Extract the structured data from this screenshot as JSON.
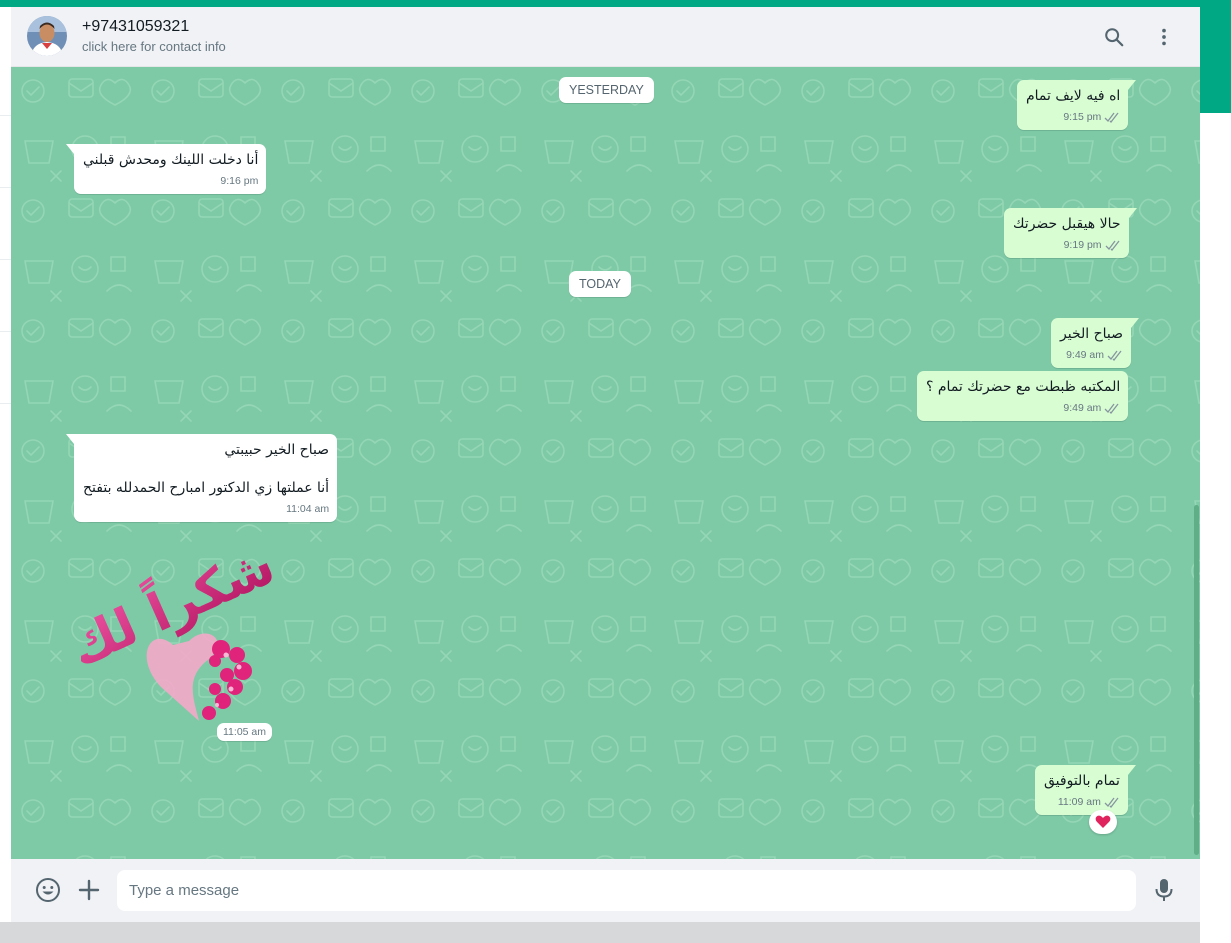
{
  "header": {
    "contact_name": "+97431059321",
    "contact_subtitle": "click here for contact info",
    "icons": {
      "avatar": "avatar",
      "search": "search-icon",
      "menu": "menu-icon"
    }
  },
  "chat": {
    "date_dividers": [
      "YESTERDAY",
      "TODAY"
    ],
    "messages": [
      {
        "dir": "out",
        "text": "اه فيه لايف تمام",
        "time": "9:15 pm",
        "status": "read"
      },
      {
        "dir": "in",
        "text": "أنا دخلت اللينك ومحدش قبلني",
        "time": "9:16 pm"
      },
      {
        "dir": "out",
        "text": "حالا هيقبل حضرتك",
        "time": "9:19 pm",
        "status": "read"
      },
      {
        "dir": "out",
        "text": "صباح الخير",
        "time": "9:49 am",
        "status": "read"
      },
      {
        "dir": "out",
        "text": "المكتبه ظبطت مع حضرتك تمام ؟",
        "time": "9:49 am",
        "status": "read"
      },
      {
        "dir": "in",
        "text": "صباح الخير حبيبتي\n\nأنا عملتها زي الدكتور امبارح الحمدلله بتفتح",
        "time": "11:04 am"
      },
      {
        "dir": "in",
        "type": "sticker",
        "sticker_text": "شكراً لك",
        "time": "11:05 am"
      },
      {
        "dir": "out",
        "text": "تمام بالتوفيق",
        "time": "11:09 am",
        "status": "read",
        "reaction": "heart-icon"
      }
    ]
  },
  "footer": {
    "placeholder": "Type a message",
    "value": "",
    "icons": {
      "emoji": "emoji-icon",
      "attach": "plus-icon",
      "voice": "mic-icon"
    }
  },
  "colors": {
    "accent": "#00a884",
    "wallpaper": "#7ecaa6",
    "outgoing_bubble": "#d9fdd3",
    "incoming_bubble": "#ffffff",
    "read_ticks": "#8696a0",
    "heart": "#e0245e"
  }
}
